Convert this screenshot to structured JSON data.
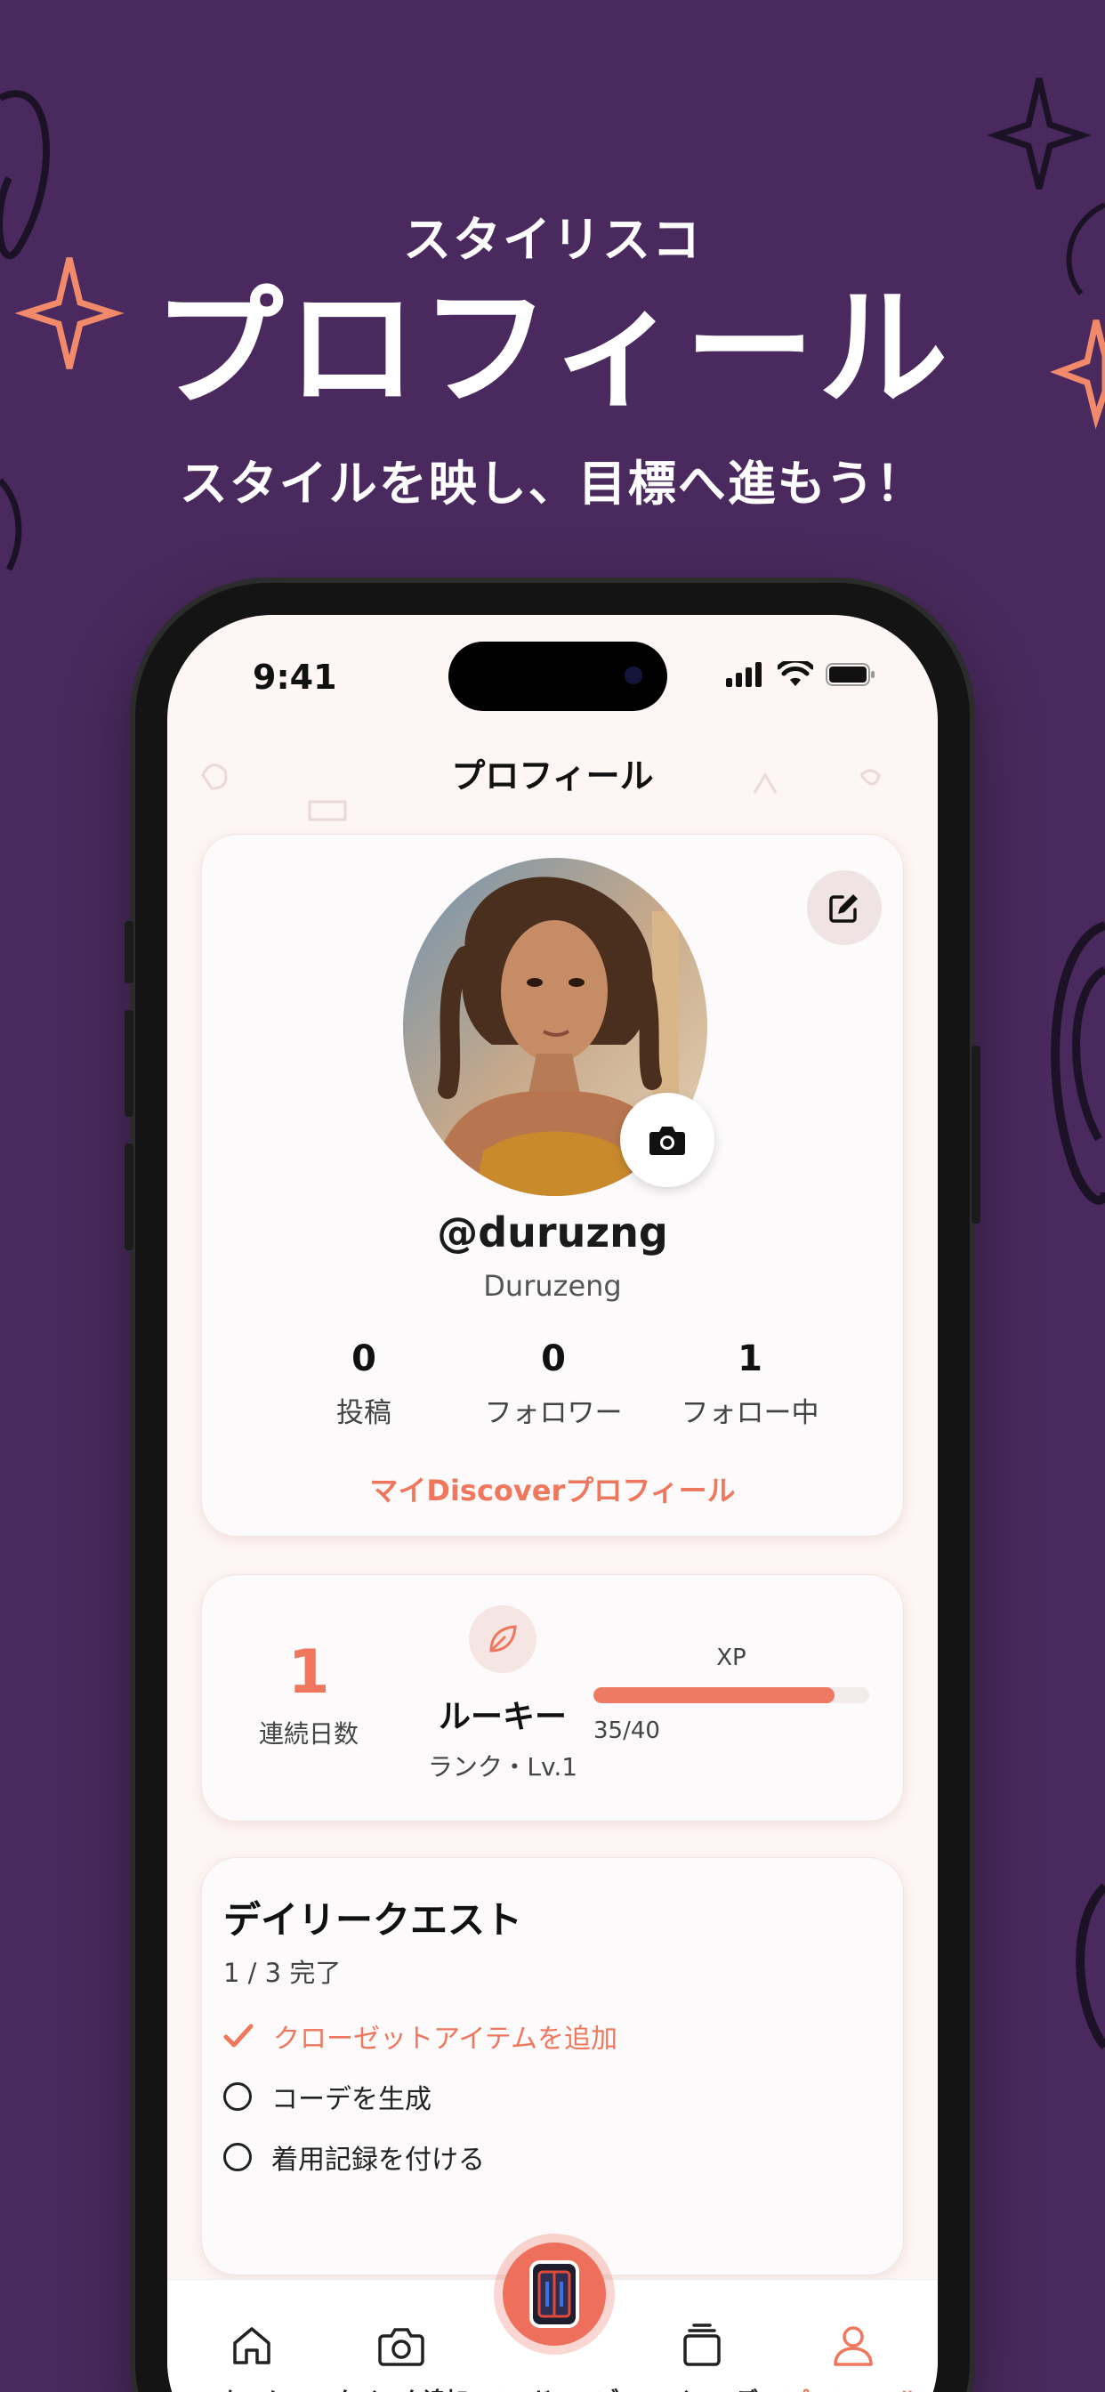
{
  "hero": {
    "app_name": "スタイリスコ",
    "title": "プロフィール",
    "tagline": "スタイルを映し、目標へ進もう！"
  },
  "status_bar": {
    "time": "9:41"
  },
  "nav": {
    "title": "プロフィール"
  },
  "profile": {
    "handle": "@duruzng",
    "display_name": "Duruzeng",
    "stats": [
      {
        "value": "0",
        "label": "投稿"
      },
      {
        "value": "0",
        "label": "フォロワー"
      },
      {
        "value": "1",
        "label": "フォロー中"
      }
    ],
    "discover_link": "マイDiscoverプロフィール"
  },
  "progress": {
    "streak_value": "1",
    "streak_label": "連続日数",
    "rank_title": "ルーキー",
    "rank_sub": "ランク・Lv.1",
    "xp_label": "XP",
    "xp_text": "35/40",
    "xp_current": 35,
    "xp_max": 40
  },
  "quests": {
    "title": "デイリークエスト",
    "progress": "1 / 3 完了",
    "items": [
      {
        "label": "クローゼットアイテムを追加",
        "done": true
      },
      {
        "label": "コーデを生成",
        "done": false
      },
      {
        "label": "着用記録を付ける",
        "done": false
      }
    ]
  },
  "tabs": [
    {
      "label": "ホーム",
      "icon": "home-icon"
    },
    {
      "label": "クイック追加",
      "icon": "camera-icon"
    },
    {
      "label": "ワードローブ",
      "icon": "wardrobe-icon"
    },
    {
      "label": "マイコーデ",
      "icon": "layers-icon"
    },
    {
      "label": "プロフィール",
      "icon": "person-icon"
    }
  ],
  "colors": {
    "background": "#4a2a5e",
    "accent": "#f0775d",
    "screen_bg": "#fdf6f5"
  }
}
